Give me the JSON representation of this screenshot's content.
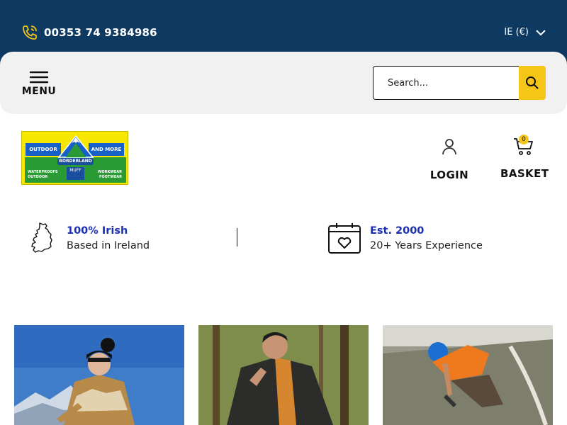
{
  "topbar": {
    "phone": "00353 74 9384986",
    "currency": "IE (€)"
  },
  "nav": {
    "menu_label": "MENU",
    "search_placeholder": "Search..."
  },
  "logo": {
    "left_band": "OUTDOOR",
    "right_band": "AND MORE",
    "banner": "BORDERLAND",
    "muff": "MUFF",
    "tag_left_1": "WATERPROOFS",
    "tag_left_2": "OUTDOOR",
    "tag_right_1": "WORKWEAR",
    "tag_right_2": "FOOTWEAR"
  },
  "actions": {
    "login_label": "LOGIN",
    "basket_label": "BASKET",
    "basket_count": "0"
  },
  "usps": [
    {
      "title": "100% Irish",
      "subtitle": "Based in Ireland"
    },
    {
      "title": "Est. 2000",
      "subtitle": "20+ Years Experience"
    }
  ],
  "colors": {
    "topbar": "#0e3a62",
    "accent_yellow": "#f5c518",
    "usp_title": "#1a2fb5",
    "navbar_bg": "#f1f1f1"
  }
}
